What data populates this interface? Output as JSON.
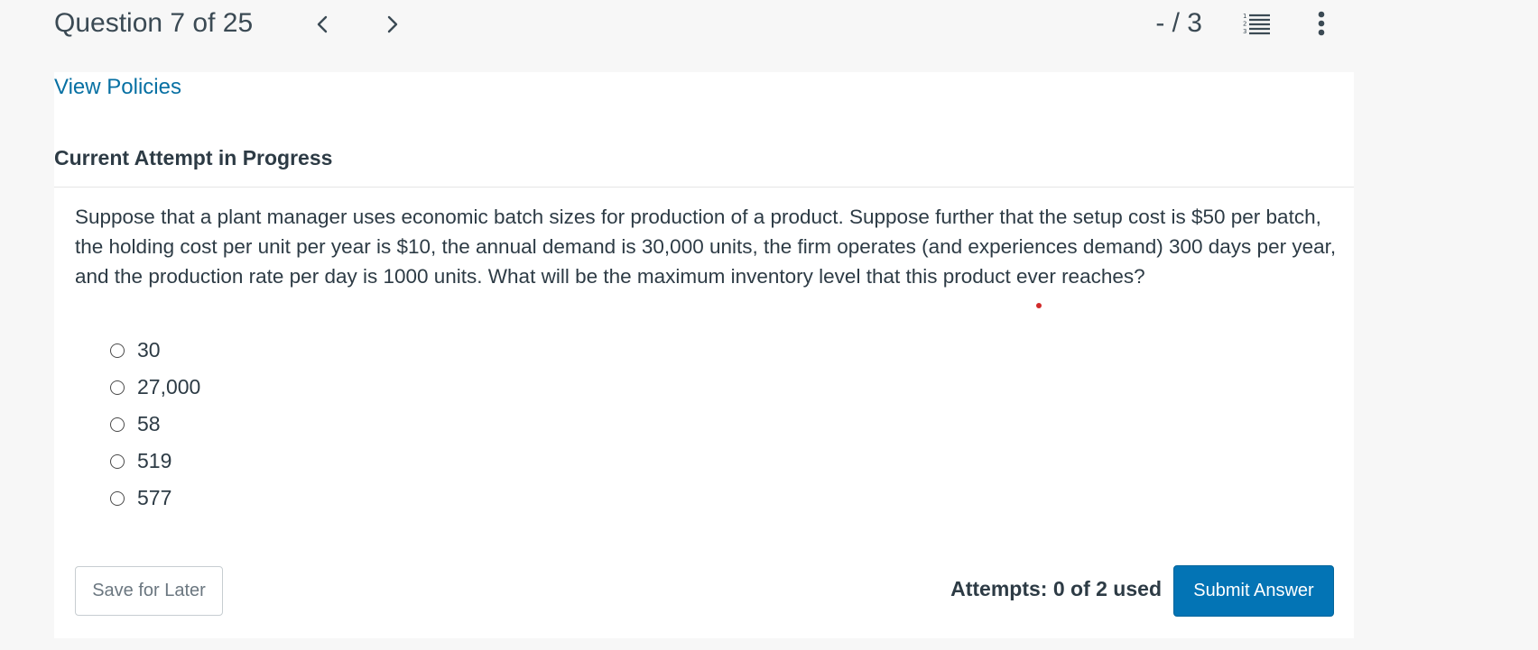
{
  "header": {
    "question_position": "Question 7 of 25",
    "score": "- / 3",
    "icons": {
      "prev": "chevron-left-icon",
      "next": "chevron-right-icon",
      "list": "numbered-list-icon",
      "more": "vertical-ellipsis-icon"
    }
  },
  "links": {
    "view_policies": "View Policies"
  },
  "attempt": {
    "heading": "Current Attempt in Progress"
  },
  "question": {
    "text": "Suppose that a plant manager uses economic batch sizes for production of a product. Suppose further that the setup cost is $50 per batch, the holding cost per unit per year is $10, the annual demand is 30,000 units, the firm operates (and experiences demand) 300 days per year, and the production rate per day is 1000 units. What will be the maximum inventory level that this product ever reaches?",
    "choices": [
      "30",
      "27,000",
      "58",
      "519",
      "577"
    ]
  },
  "footer": {
    "save_label": "Save for Later",
    "attempts_text": "Attempts: 0 of 2 used",
    "submit_label": "Submit Answer"
  },
  "colors": {
    "link": "#0770a3",
    "primary_button": "#0374b5",
    "text": "#2d3b45",
    "background": "#f7f7f7",
    "card": "#ffffff"
  }
}
